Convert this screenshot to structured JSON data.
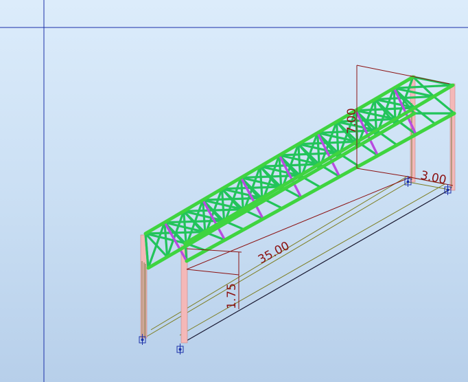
{
  "view": {
    "background_top": "#dcecfb",
    "background_bottom": "#b7cfea",
    "axis_line_color": "#1a2fa8"
  },
  "structure": {
    "type": "steel-truss-footbridge-3d",
    "chord_color": "#3fd43f",
    "diagonal_color": "#b84be0",
    "support_color": "#f4b8b8",
    "dimension_color": "#8b1010"
  },
  "dimensions": {
    "span": "35.00",
    "height": "7.00",
    "width": "3.00",
    "elevation": "1.75"
  },
  "supports": [
    {
      "id": "support-front-left",
      "icon": "pinned-support-icon"
    },
    {
      "id": "support-front-right",
      "icon": "pinned-support-icon"
    },
    {
      "id": "support-back-left",
      "icon": "pinned-support-icon"
    },
    {
      "id": "support-back-right",
      "icon": "pinned-support-icon"
    }
  ]
}
